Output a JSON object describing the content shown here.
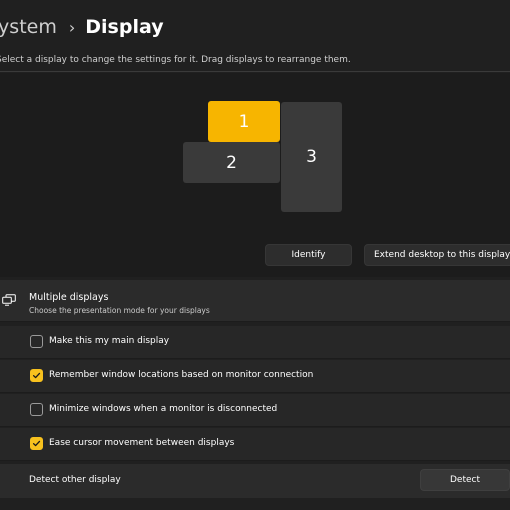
{
  "breadcrumb": {
    "parent": "System",
    "separator": "›",
    "current": "Display"
  },
  "instruction": "Select a display to change the settings for it. Drag displays to rearrange them.",
  "monitors": [
    {
      "label": "1",
      "selected": true
    },
    {
      "label": "2",
      "selected": false
    },
    {
      "label": "3",
      "selected": false
    }
  ],
  "arrangement_actions": {
    "identify_label": "Identify",
    "mode_selected": "Extend desktop to this display"
  },
  "multiple_displays": {
    "icon": "multiple-displays-icon",
    "title": "Multiple displays",
    "subtitle": "Choose the presentation mode for your displays",
    "options": [
      {
        "label": "Make this my main display",
        "checked": false
      },
      {
        "label": "Remember window locations based on monitor connection",
        "checked": true
      },
      {
        "label": "Minimize windows when a monitor is disconnected",
        "checked": false
      },
      {
        "label": "Ease cursor movement between displays",
        "checked": true
      }
    ],
    "detect": {
      "label": "Detect other display",
      "button_label": "Detect"
    }
  },
  "colors": {
    "accent": "#f7b500",
    "checkbox_checked": "#f7c11e",
    "background": "#202020"
  }
}
